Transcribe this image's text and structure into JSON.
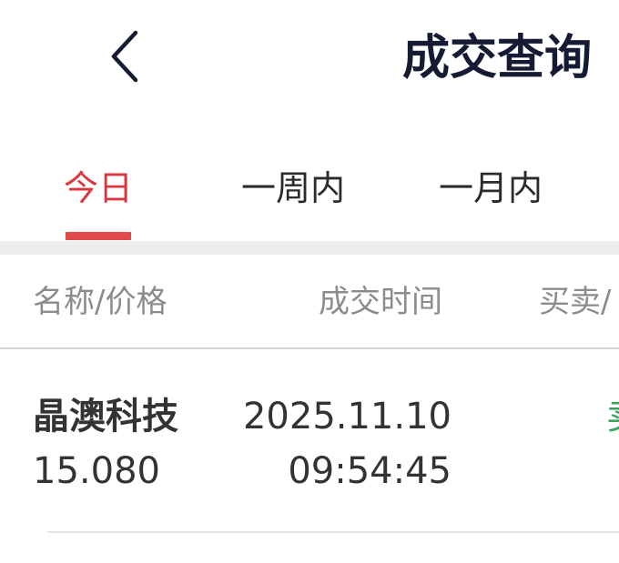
{
  "header": {
    "back_icon": "chevron-left-icon",
    "title": "成交查询"
  },
  "tabs": [
    {
      "label": "今日",
      "active": true
    },
    {
      "label": "一周内",
      "active": false
    },
    {
      "label": "一月内",
      "active": false
    }
  ],
  "table": {
    "columns": [
      "名称/价格",
      "成交时间",
      "买卖/"
    ],
    "rows": [
      {
        "name": "晶澳科技",
        "price": "15.080",
        "date": "2025.11.10",
        "time": "09:54:45",
        "side": "卖"
      }
    ]
  },
  "colors": {
    "accent": "#d9363e",
    "indicator": "#e0484c",
    "title": "#141b33",
    "sell": "#3aa55a"
  }
}
